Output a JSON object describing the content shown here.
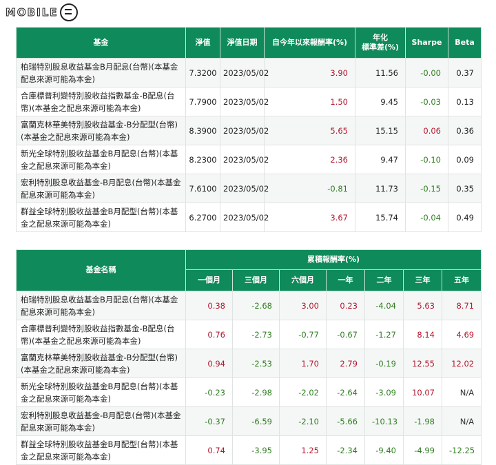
{
  "logo": {
    "text": "MOBILE"
  },
  "table1": {
    "headers": {
      "fund": "基金",
      "nav": "淨值",
      "date": "淨值日期",
      "ytd": "自今年以來報酬率(%)",
      "std_line1": "年化",
      "std_line2": "標準差(%)",
      "sharpe": "Sharpe",
      "beta": "Beta"
    },
    "rows": [
      {
        "name": "柏瑞特別股息收益基金B月配息(台幣)(本基金配息來源可能為本金)",
        "nav": "7.3200",
        "date": "2023/05/02",
        "ytd": "3.90",
        "std": "11.56",
        "sharpe": "-0.00",
        "beta": "0.37"
      },
      {
        "name": "合庫標普利變特別股收益指數基金-B配息(台幣)(本基金之配息來源可能為本金)",
        "nav": "7.7900",
        "date": "2023/05/02",
        "ytd": "1.50",
        "std": "9.45",
        "sharpe": "-0.03",
        "beta": "0.13"
      },
      {
        "name": "富蘭克林華美特別股收益基金-B分配型(台幣)(本基金之配息來源可能為本金)",
        "nav": "8.3900",
        "date": "2023/05/02",
        "ytd": "5.65",
        "std": "15.15",
        "sharpe": "0.06",
        "beta": "0.36"
      },
      {
        "name": "新光全球特別股收益基金B月配息(台幣)(本基金之配息來源可能為本金)",
        "nav": "8.2300",
        "date": "2023/05/02",
        "ytd": "2.36",
        "std": "9.47",
        "sharpe": "-0.10",
        "beta": "0.09"
      },
      {
        "name": "宏利特別股息收益基金-B月配息(台幣)(本基金配息來源可能為本金)",
        "nav": "7.6100",
        "date": "2023/05/02",
        "ytd": "-0.81",
        "std": "11.73",
        "sharpe": "-0.15",
        "beta": "0.35"
      },
      {
        "name": "群益全球特別股收益基金B月配型(台幣)(本基金之配息來源可能為本金)",
        "nav": "6.2700",
        "date": "2023/05/02",
        "ytd": "3.67",
        "std": "15.74",
        "sharpe": "-0.04",
        "beta": "0.49"
      }
    ]
  },
  "table2": {
    "headers": {
      "fund_name": "基金名稱",
      "cumulative": "累積報酬率(%)",
      "m1": "一個月",
      "m3": "三個月",
      "m6": "六個月",
      "y1": "一年",
      "y2": "二年",
      "y3": "三年",
      "y5": "五年"
    },
    "rows": [
      {
        "name": "柏瑞特別股息收益基金B月配息(台幣)(本基金配息來源可能為本金)",
        "m1": "0.38",
        "m3": "-2.68",
        "m6": "3.00",
        "y1": "0.23",
        "y2": "-4.04",
        "y3": "5.63",
        "y5": "8.71"
      },
      {
        "name": "合庫標普利變特別股收益指數基金-B配息(台幣)(本基金之配息來源可能為本金)",
        "m1": "0.76",
        "m3": "-2.73",
        "m6": "-0.77",
        "y1": "-0.67",
        "y2": "-1.27",
        "y3": "8.14",
        "y5": "4.69"
      },
      {
        "name": "富蘭克林華美特別股收益基金-B分配型(台幣)(本基金之配息來源可能為本金)",
        "m1": "0.94",
        "m3": "-2.53",
        "m6": "1.70",
        "y1": "2.79",
        "y2": "-0.19",
        "y3": "12.55",
        "y5": "12.02"
      },
      {
        "name": "新光全球特別股收益基金B月配息(台幣)(本基金之配息來源可能為本金)",
        "m1": "-0.23",
        "m3": "-2.98",
        "m6": "-2.02",
        "y1": "-2.64",
        "y2": "-3.09",
        "y3": "10.07",
        "y5": "N/A"
      },
      {
        "name": "宏利特別股息收益基金-B月配息(台幣)(本基金配息來源可能為本金)",
        "m1": "-0.37",
        "m3": "-6.59",
        "m6": "-2.10",
        "y1": "-5.66",
        "y2": "-10.13",
        "y3": "-1.98",
        "y5": "N/A"
      },
      {
        "name": "群益全球特別股收益基金B月配型(台幣)(本基金之配息來源可能為本金)",
        "m1": "0.74",
        "m3": "-3.95",
        "m6": "1.25",
        "y1": "-2.34",
        "y2": "-9.40",
        "y3": "-4.99",
        "y5": "-12.25"
      }
    ]
  },
  "colors": {
    "header_green": "#0f8a5a",
    "positive_red": "#b3162e",
    "negative_green": "#2e7d1f"
  }
}
